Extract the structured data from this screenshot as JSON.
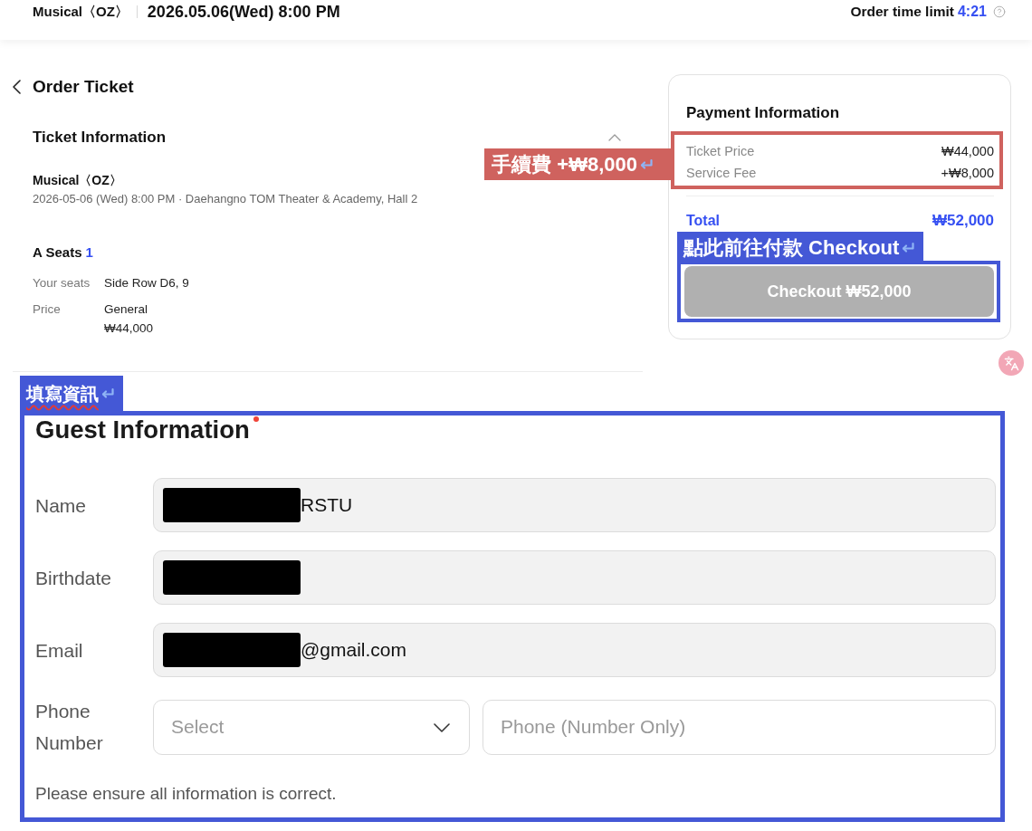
{
  "header": {
    "show_title": "Musical〈OZ〉",
    "datetime": "2026.05.06(Wed) 8:00 PM",
    "time_limit_label": "Order time limit",
    "time_limit": "4:21"
  },
  "page_title": "Order Ticket",
  "ticket_info": {
    "title": "Ticket Information",
    "expanded": true,
    "show_title": "Musical〈OZ〉",
    "details": "2026-05-06 (Wed) 8:00 PM · Daehangno TOM Theater & Academy, Hall 2",
    "seat_grade": "A Seats",
    "seat_count": "1",
    "rows": [
      {
        "label": "Your seats",
        "values": [
          "Side Row D6, 9"
        ]
      },
      {
        "label": "Price",
        "values": [
          "General",
          "₩44,000"
        ]
      }
    ]
  },
  "payment": {
    "title": "Payment Information",
    "fee_callout": "手續費 +₩8,000",
    "lines": [
      {
        "label": "Ticket Price",
        "amount": "₩44,000"
      },
      {
        "label": "Service Fee",
        "amount": "+₩8,000"
      }
    ],
    "total_label": "Total",
    "total": "₩52,000",
    "checkout_callout": "點此前往付款 Checkout",
    "checkout_button": {
      "label": "Checkout ₩52,000",
      "disabled": true
    }
  },
  "guest_info": {
    "callout": "填寫資訊",
    "title": "Guest Information",
    "required": true,
    "fields": [
      {
        "kind": "text",
        "label": "Name",
        "redacted": true,
        "value": "RSTU"
      },
      {
        "kind": "text",
        "label": "Birthdate",
        "redacted": true
      },
      {
        "kind": "text",
        "label": "Email",
        "redacted": true,
        "value": "@gmail.com"
      },
      {
        "kind": "phone",
        "label": "Phone Number",
        "code_select": {
          "placeholder": "Select"
        },
        "number_input": {
          "placeholder": "Phone (Number Only)"
        }
      }
    ],
    "note": "Please ensure all information is correct."
  }
}
